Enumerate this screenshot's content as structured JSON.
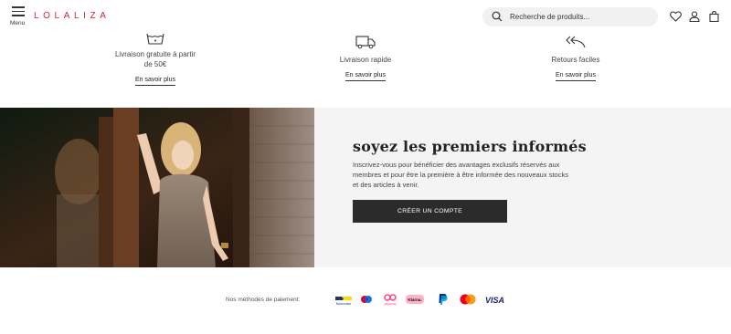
{
  "header": {
    "menu_label": "Menu",
    "logo": "LOLALIZA",
    "search_placeholder": "Recherche de produits...",
    "icons": [
      "search-icon",
      "heart-icon",
      "user-icon",
      "bag-icon"
    ]
  },
  "benefits": [
    {
      "icon": "wash-icon",
      "title_line1": "Livraison gratuite à partir",
      "title_line2": "de 50€",
      "link": "En savoir plus"
    },
    {
      "icon": "truck-icon",
      "title": "Livraison rapide",
      "link": "En savoir plus"
    },
    {
      "icon": "return-arrows-icon",
      "title": "Retours faciles",
      "link": "En savoir plus"
    }
  ],
  "hero": {
    "title": "soyez les premiers informés",
    "text": "Inscrivez-vous pour bénéficier des avantages exclusifs réservés aux membres et pour être la première à être informée des nouveaux stocks et des articles à venir.",
    "cta": "CRÉER UN COMPTE"
  },
  "payment": {
    "label": "Nos méthodes de paiement:",
    "methods": [
      "Bancontact",
      "Maestro",
      "payconiq",
      "Klarna.",
      "PayPal",
      "Mastercard",
      "VISA"
    ]
  },
  "colors": {
    "brand": "#d7263d",
    "cta_bg": "#2b2b2b",
    "panel_bg": "#f4f4f4"
  }
}
